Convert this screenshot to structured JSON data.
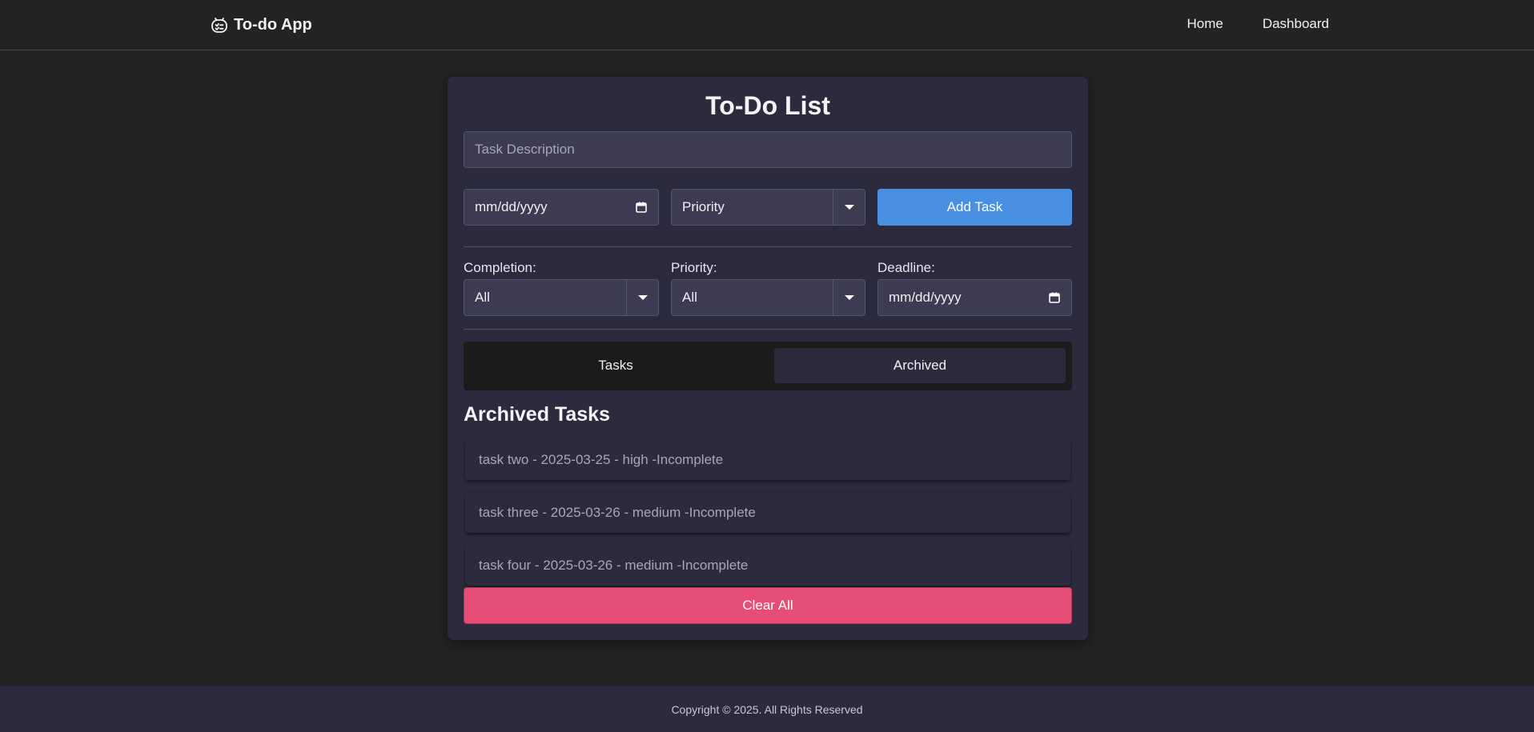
{
  "navbar": {
    "brand_icon": "robot-checklist-icon",
    "brand_label": "To-do App",
    "links": [
      "Home",
      "Dashboard"
    ]
  },
  "card": {
    "title": "To-Do List",
    "task_description_placeholder": "Task Description",
    "date_value": "mm/dd/yyyy",
    "priority_select": "Priority",
    "add_task_label": "Add Task"
  },
  "filters": {
    "completion_label": "Completion:",
    "completion_value": "All",
    "priority_label": "Priority:",
    "priority_value": "All",
    "deadline_label": "Deadline:",
    "deadline_value": "mm/dd/yyyy"
  },
  "tabs": {
    "tasks": "Tasks",
    "archived": "Archived",
    "active": "Archived"
  },
  "archived": {
    "title": "Archived Tasks",
    "items": [
      "task two - 2025-03-25 - high -Incomplete",
      "task three - 2025-03-26 - medium -Incomplete",
      "task four - 2025-03-26 - medium -Incomplete"
    ]
  },
  "clear_all_label": "Clear All",
  "footer": {
    "copyright": "Copyright © 2025. All Rights Reserved"
  },
  "colors": {
    "background": "#232323",
    "card": "#2c2b3d",
    "accent_blue": "#4a90e2",
    "danger_pink": "#e64e78"
  }
}
